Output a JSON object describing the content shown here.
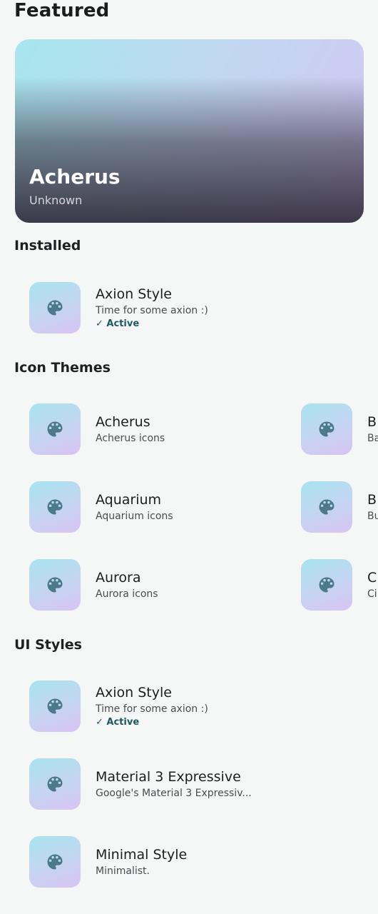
{
  "page_title": "Featured",
  "featured": {
    "name": "Acherus",
    "author": "Unknown"
  },
  "sections": {
    "installed": "Installed",
    "icon_themes": "Icon Themes",
    "ui_styles": "UI Styles"
  },
  "installed": [
    {
      "name": "Axion Style",
      "description": "Time for some axion :)",
      "status": "✓ Active"
    }
  ],
  "icon_themes": [
    {
      "name": "Acherus",
      "description": "Acherus icons"
    },
    {
      "name": "Aquarium",
      "description": "Aquarium icons"
    },
    {
      "name": "Aurora",
      "description": "Aurora icons"
    },
    {
      "name": "B",
      "description": "Ba"
    },
    {
      "name": "B",
      "description": "Bu"
    },
    {
      "name": "C",
      "description": "Ci"
    }
  ],
  "ui_styles": [
    {
      "name": "Axion Style",
      "description": "Time for some axion :)",
      "status": "✓ Active"
    },
    {
      "name": "Material 3 Expressive",
      "description": "Google's Material 3 Expressiv..."
    },
    {
      "name": "Minimal Style",
      "description": "Minimalist."
    }
  ],
  "icons": {
    "item_icon": "palette-icon"
  },
  "colors": {
    "background": "#f5f6f6",
    "accent": "#1d5a63",
    "icon": "#4a7a8c"
  }
}
